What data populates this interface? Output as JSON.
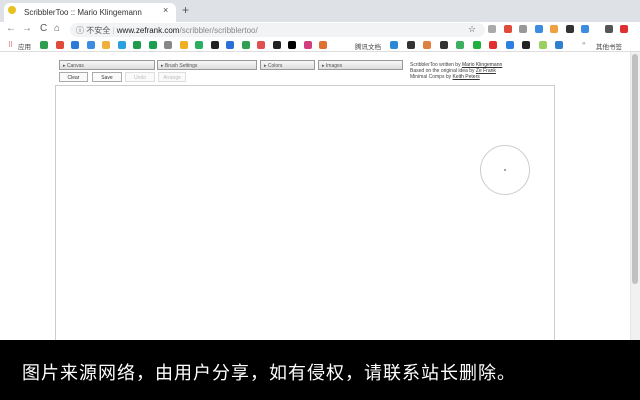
{
  "browser": {
    "tab_title": "ScribblerToo :: Mario Klingemann",
    "close": "×",
    "new_tab": "+",
    "back": "←",
    "forward": "→",
    "reload": "C",
    "home": "⌂",
    "security_label": "ⓘ 不安全",
    "url_host": "www.zefrank.com",
    "url_path": "/scribbler/scribblertoo/",
    "star": "☆",
    "bookmarks_apps": "应用",
    "bookmark_tencent": "腾讯文档",
    "other_bookmarks": "其他书签",
    "more": "»",
    "bookmark_colors": [
      "#2e9e4f",
      "#e04a3a",
      "#2a7bd8",
      "#3a8de0",
      "#f0b040",
      "#2aa0e0",
      "#1f9b4b",
      "#1aa050",
      "#888888",
      "#f0b020",
      "#2cae60",
      "#222222",
      "#2a6fd8",
      "#30a050",
      "#e05050",
      "#222222",
      "#000000",
      "#d04080",
      "#e07030"
    ],
    "bookmark_colors2": [
      "#2a8ad8",
      "#333333",
      "#e08040",
      "#333333",
      "#3cb060",
      "#20b040",
      "#e03030",
      "#2a80e0",
      "#222222",
      "#9ad060",
      "#3080d0"
    ]
  },
  "app": {
    "panels": [
      "Canvas",
      "Brush Settings",
      "Colors",
      "Images"
    ],
    "buttons": {
      "clear": "Clear",
      "save": "Save",
      "undo": "Undo",
      "arrange": "Arrange"
    },
    "credits": {
      "line1_prefix": "ScribblerToo written by ",
      "line1_link": "Mario Klingemann",
      "line2_prefix": "Based on the original idea by ",
      "line2_link": "Ze Frank",
      "line3_prefix": "Minimal Comps by ",
      "line3_link": "Keith Peters"
    }
  },
  "banner": {
    "text": "图片来源网络，由用户分享，如有侵权，请联系站长删除。"
  }
}
